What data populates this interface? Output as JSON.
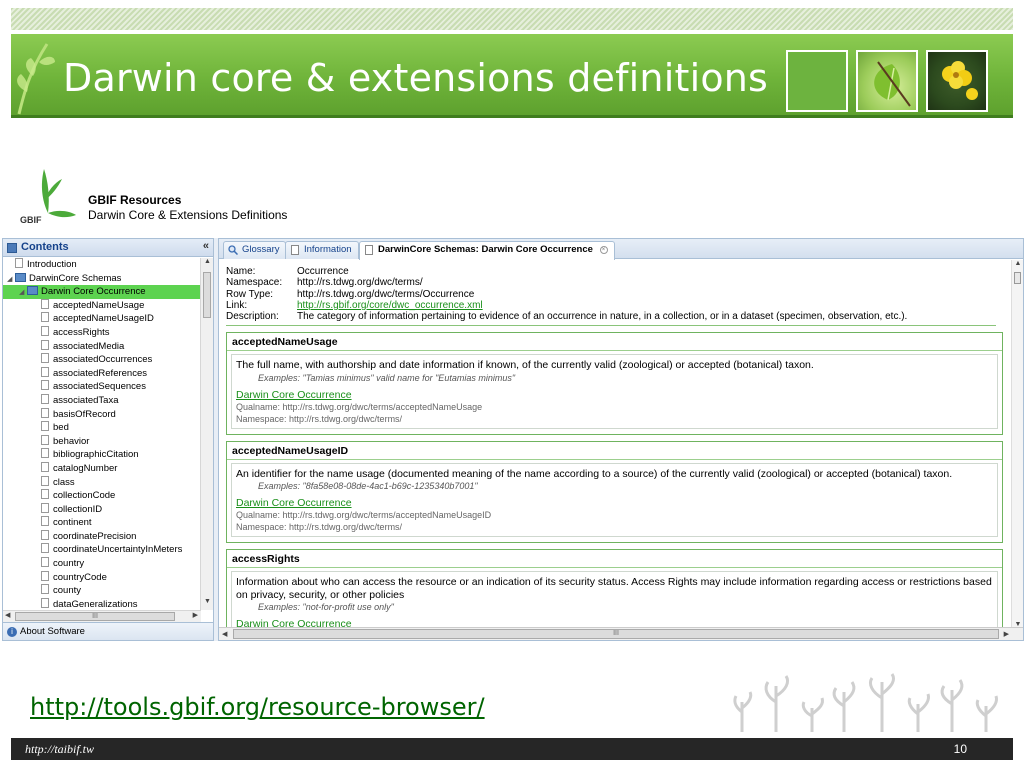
{
  "slide": {
    "title": "Darwin core & extensions definitions",
    "url": "http://tools.gbif.org/resource-browser/",
    "footer_url": "http://taibif.tw",
    "page_number": "10"
  },
  "app": {
    "logo_text": "GBIF",
    "title": "GBIF Resources",
    "subtitle": "Darwin Core & Extensions Definitions"
  },
  "sidebar": {
    "header": "Contents",
    "collapse": "«",
    "about": "About Software",
    "hscroll_label": "III",
    "items": [
      {
        "label": "Introduction",
        "level": 1,
        "kind": "doc"
      },
      {
        "label": "DarwinCore Schemas",
        "level": 0,
        "kind": "folder"
      },
      {
        "label": "Darwin Core Occurrence",
        "level": 1,
        "kind": "folder",
        "selected": true
      },
      {
        "label": "acceptedNameUsage",
        "level": 2,
        "kind": "doc"
      },
      {
        "label": "acceptedNameUsageID",
        "level": 2,
        "kind": "doc"
      },
      {
        "label": "accessRights",
        "level": 2,
        "kind": "doc"
      },
      {
        "label": "associatedMedia",
        "level": 2,
        "kind": "doc"
      },
      {
        "label": "associatedOccurrences",
        "level": 2,
        "kind": "doc"
      },
      {
        "label": "associatedReferences",
        "level": 2,
        "kind": "doc"
      },
      {
        "label": "associatedSequences",
        "level": 2,
        "kind": "doc"
      },
      {
        "label": "associatedTaxa",
        "level": 2,
        "kind": "doc"
      },
      {
        "label": "basisOfRecord",
        "level": 2,
        "kind": "doc"
      },
      {
        "label": "bed",
        "level": 2,
        "kind": "doc"
      },
      {
        "label": "behavior",
        "level": 2,
        "kind": "doc"
      },
      {
        "label": "bibliographicCitation",
        "level": 2,
        "kind": "doc"
      },
      {
        "label": "catalogNumber",
        "level": 2,
        "kind": "doc"
      },
      {
        "label": "class",
        "level": 2,
        "kind": "doc"
      },
      {
        "label": "collectionCode",
        "level": 2,
        "kind": "doc"
      },
      {
        "label": "collectionID",
        "level": 2,
        "kind": "doc"
      },
      {
        "label": "continent",
        "level": 2,
        "kind": "doc"
      },
      {
        "label": "coordinatePrecision",
        "level": 2,
        "kind": "doc"
      },
      {
        "label": "coordinateUncertaintyInMeters",
        "level": 2,
        "kind": "doc"
      },
      {
        "label": "country",
        "level": 2,
        "kind": "doc"
      },
      {
        "label": "countryCode",
        "level": 2,
        "kind": "doc"
      },
      {
        "label": "county",
        "level": 2,
        "kind": "doc"
      },
      {
        "label": "dataGeneralizations",
        "level": 2,
        "kind": "doc"
      }
    ]
  },
  "tabs": [
    {
      "label": "Glossary",
      "icon": "search-icon"
    },
    {
      "label": "Information",
      "icon": "document-icon"
    },
    {
      "label": "DarwinCore Schemas: Darwin Core Occurrence",
      "icon": "document-icon",
      "active": true
    }
  ],
  "meta": {
    "name_key": "Name:",
    "name": "Occurrence",
    "namespace_key": "Namespace:",
    "namespace": "http://rs.tdwg.org/dwc/terms/",
    "rowtype_key": "Row Type:",
    "rowtype": "http://rs.tdwg.org/dwc/terms/Occurrence",
    "link_key": "Link:",
    "link": "http://rs.gbif.org/core/dwc_occurrence.xml",
    "description_key": "Description:",
    "description": "The category of information pertaining to evidence of an occurrence in nature, in a collection, or in a dataset (specimen, observation, etc.)."
  },
  "terms": [
    {
      "name": "acceptedNameUsage",
      "description": "The full name, with authorship and date information if known, of the currently valid (zoological) or accepted (botanical) taxon.",
      "example": "Examples: \"Tamias minimus\" valid name for \"Eutamias minimus\"",
      "link": "Darwin Core Occurrence",
      "qualname": "Qualname: http://rs.tdwg.org/dwc/terms/acceptedNameUsage",
      "namespace": "Namespace: http://rs.tdwg.org/dwc/terms/"
    },
    {
      "name": "acceptedNameUsageID",
      "description": "An identifier for the name usage (documented meaning of the name according to a source) of the currently valid (zoological) or accepted (botanical) taxon.",
      "example": "Examples: \"8fa58e08-08de-4ac1-b69c-1235340b7001\"",
      "link": "Darwin Core Occurrence",
      "qualname": "Qualname: http://rs.tdwg.org/dwc/terms/acceptedNameUsageID",
      "namespace": "Namespace: http://rs.tdwg.org/dwc/terms/"
    },
    {
      "name": "accessRights",
      "description": "Information about who can access the resource or an indication of its security status. Access Rights may include information regarding access or restrictions based on privacy, security, or other policies",
      "example": "Examples: \"not-for-profit use only\"",
      "link": "Darwin Core Occurrence"
    }
  ],
  "main_hscroll_label": "III",
  "colors": {
    "brand_green": "#6fb43a",
    "link_green": "#1a8f1a",
    "selected_green": "#5dd350",
    "panel_border": "#a9bfd6"
  }
}
